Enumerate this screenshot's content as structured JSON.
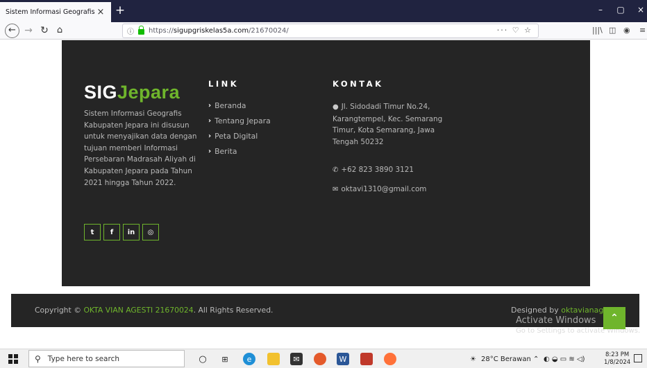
{
  "browser": {
    "tab_title": "Sistem Informasi Geografis",
    "tab_close": "×",
    "new_tab": "+",
    "url_prefix": "https://",
    "url_domain": "sigupgriskelas5a.com",
    "url_path": "/21670024/",
    "url_actions": "··· ♡ ☆",
    "window_controls": [
      "–",
      "▢",
      "×"
    ]
  },
  "brand": {
    "prefix": "SIG",
    "accent": "Jepara"
  },
  "about": "Sistem Informasi Geografis Kabupaten Jepara ini disusun untuk menyajikan data dengan tujuan memberi Informasi Persebaran Madrasah Aliyah di Kabupaten Jepara pada Tahun 2021 hingga Tahun 2022.",
  "socials": [
    {
      "icon": "twitter-icon",
      "glyph": "t"
    },
    {
      "icon": "facebook-icon",
      "glyph": "f"
    },
    {
      "icon": "linkedin-icon",
      "glyph": "in"
    },
    {
      "icon": "instagram-icon",
      "glyph": "◎"
    }
  ],
  "link_section": {
    "title": "LINK",
    "items": [
      "Beranda",
      "Tentang Jepara",
      "Peta Digital",
      "Berita"
    ]
  },
  "contact_section": {
    "title": "KONTAK",
    "address": "Jl. Sidodadi Timur No.24, Karangtempel, Kec. Semarang Timur, Kota Semarang, Jawa Tengah 50232",
    "phone": "+62 823 3890 3121",
    "email": "oktavi1310@gmail.com"
  },
  "copyright": {
    "prefix": "Copyright ©",
    "name": "OKTA VIAN AGESTI 21670024",
    "suffix": ". All Rights Reserved."
  },
  "designed_by": {
    "prefix": "Designed by",
    "name": "oktavianag"
  },
  "watermark": {
    "title": "Activate Windows",
    "subtitle": "Go to Settings to activate Windows."
  },
  "taskbar": {
    "search_placeholder": "Type here to search",
    "weather": "28°C Berawan",
    "time": "8:23 PM",
    "date": "1/8/2024"
  },
  "colors": {
    "accent": "#6fb52c",
    "footer_bg": "#252525"
  }
}
